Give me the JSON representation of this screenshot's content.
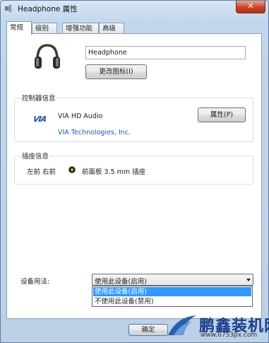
{
  "window": {
    "title": "Headphone 属性",
    "close_glyph": "✕"
  },
  "tabs": [
    {
      "label": "常规",
      "active": true
    },
    {
      "label": "级别",
      "active": false
    },
    {
      "label": "增强功能",
      "active": false
    },
    {
      "label": "高级",
      "active": false
    }
  ],
  "device": {
    "icon": "headphone-icon",
    "name_value": "Headphone",
    "change_icon_label": "更改图标(I)"
  },
  "controller": {
    "group_label": "控制器信息",
    "logo_text": "VIA",
    "name": "VIA HD Audio",
    "vendor": "VIA Technologies, Inc.",
    "properties_label": "属性(P)"
  },
  "jack": {
    "group_label": "插座信息",
    "position": "左前 右前",
    "description": "前面板 3.5 mm 插座"
  },
  "usage": {
    "label": "设备用法:",
    "selected": "使用此设备(启用)",
    "options": [
      "使用此设备(启用)",
      "不使用此设备(禁用)"
    ]
  },
  "footer": {
    "ok_label": "确定"
  },
  "watermark": {
    "name": "鹏鑫装机网",
    "url": "www.0753px.com"
  },
  "colors": {
    "link": "#1c5ab3",
    "highlight": "#3399ff",
    "via_logo": "#1d4f9c"
  }
}
